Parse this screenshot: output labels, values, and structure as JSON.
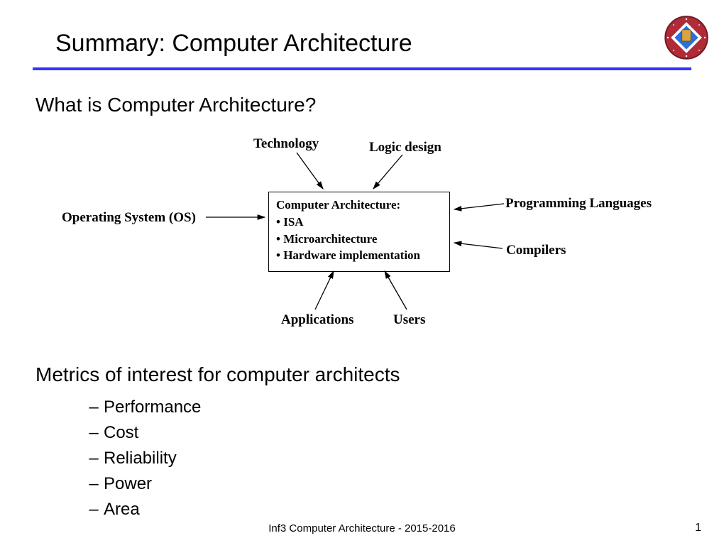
{
  "title": "Summary: Computer Architecture",
  "section1": "What is Computer Architecture?",
  "diagram": {
    "top_left": "Technology",
    "top_right": "Logic design",
    "left": "Operating System (OS)",
    "right_top": "Programming Languages",
    "right_bottom": "Compilers",
    "bottom_left": "Applications",
    "bottom_right": "Users",
    "box_title": "Computer Architecture:",
    "box_item1": "• ISA",
    "box_item2": "• Microarchitecture",
    "box_item3": "• Hardware implementation"
  },
  "section2": "Metrics of interest for computer architects",
  "dash": "–",
  "metrics": {
    "m0": "Performance",
    "m1": "Cost",
    "m2": "Reliability",
    "m3": "Power",
    "m4": "Area"
  },
  "footer": {
    "center": "Inf3 Computer Architecture - 2015-2016",
    "page": "1"
  }
}
